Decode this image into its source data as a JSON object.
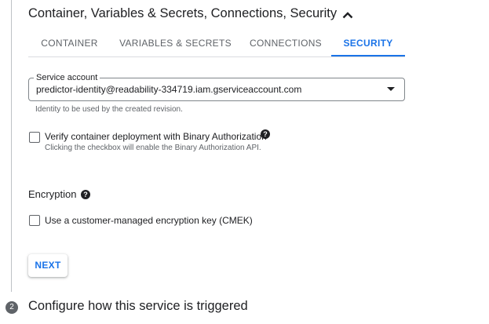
{
  "section": {
    "title": "Container, Variables & Secrets, Connections, Security",
    "collapse_icon": "chevron-up-icon"
  },
  "tabs": [
    {
      "label": "CONTAINER",
      "active": false
    },
    {
      "label": "VARIABLES & SECRETS",
      "active": false
    },
    {
      "label": "CONNECTIONS",
      "active": false
    },
    {
      "label": "SECURITY",
      "active": true
    }
  ],
  "service_account": {
    "label": "Service account",
    "value": "predictor-identity@readability-334719.iam.gserviceaccount.com",
    "hint": "Identity to be used by the created revision."
  },
  "binary_auth": {
    "label": "Verify container deployment with Binary Authorization",
    "hint": "Clicking the checkbox will enable the Binary Authorization API.",
    "checked": false,
    "help_icon": "?"
  },
  "encryption": {
    "heading": "Encryption",
    "help_icon": "?",
    "cmek_label": "Use a customer-managed encryption key (CMEK)",
    "cmek_checked": false
  },
  "next_button": {
    "label": "NEXT"
  },
  "next_step": {
    "number": "2",
    "title": "Configure how this service is triggered"
  },
  "colors": {
    "accent": "#1a73e8",
    "text": "#202124",
    "secondary_text": "#5f6368",
    "divider": "#dadce0"
  }
}
